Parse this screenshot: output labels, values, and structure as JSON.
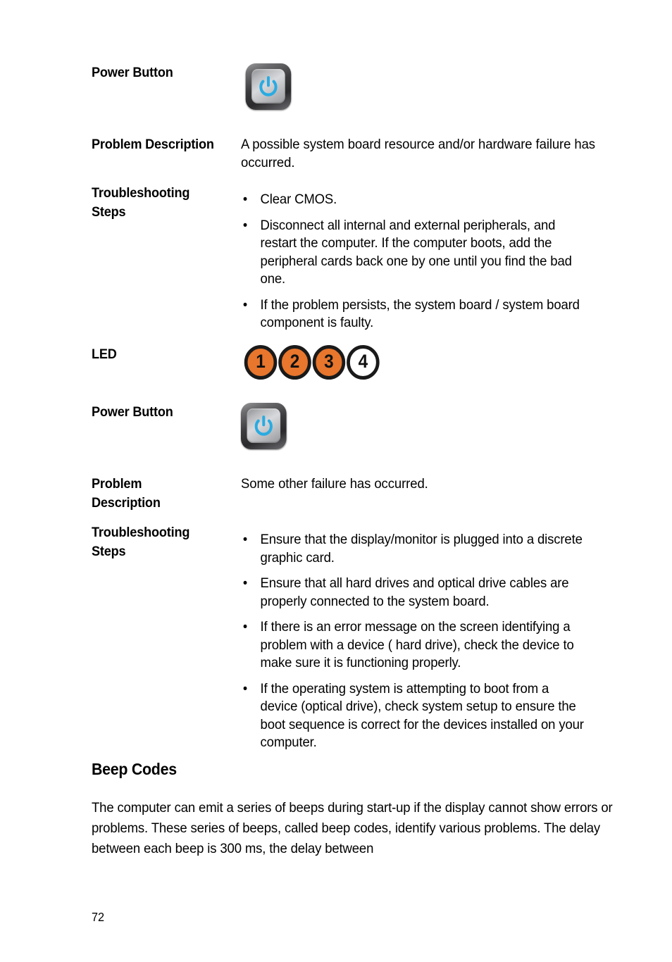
{
  "document": {
    "page_number": "72",
    "colors": {
      "led_on": "#e8762c",
      "led_off": "#ffffff",
      "power_glyph": "#29abe2",
      "text": "#000000"
    }
  },
  "blocks": {
    "power_button_1": {
      "label": "Power Button",
      "icon": "power-button-icon"
    },
    "problem_description_1": {
      "label": "Problem Description",
      "text": "A possible system board resource and/or hardware failure has occurred."
    },
    "troubleshooting_steps_1": {
      "label": "Troubleshooting\nSteps",
      "bullet_marker": "•",
      "steps": [
        "Clear CMOS.",
        "Disconnect all internal and external peripherals, and restart the computer. If the computer boots, add the peripheral cards back one by one until you find the bad one.",
        "If the problem persists, the system board / system board component is faulty."
      ]
    },
    "led": {
      "label": "LED",
      "indicators": [
        {
          "number": "1",
          "state": "on"
        },
        {
          "number": "2",
          "state": "on"
        },
        {
          "number": "3",
          "state": "on"
        },
        {
          "number": "4",
          "state": "off"
        }
      ]
    },
    "power_button_2": {
      "label": "Power Button",
      "icon": "power-button-icon"
    },
    "problem_description_2": {
      "label": "Problem\nDescription",
      "text": "Some other failure has occurred."
    },
    "troubleshooting_steps_2": {
      "label": "Troubleshooting\nSteps",
      "bullet_marker": "•",
      "steps": [
        "Ensure that the display/monitor is plugged into a discrete graphic card.",
        "Ensure that all hard drives and optical drive cables are properly connected to the system board.",
        "If there is an error message on the screen identifying a problem with a device ( hard drive), check the device to make sure it is functioning properly.",
        "If the operating system is attempting to boot from a device (optical drive), check system setup to ensure the boot sequence is correct for the devices installed on your computer."
      ]
    },
    "beep_codes": {
      "heading": "Beep Codes",
      "paragraph": "The computer can emit a series of beeps during start-up if the display cannot show errors or problems. These series of beeps, called beep codes, identify various problems. The delay between each beep is 300 ms, the delay between"
    }
  }
}
